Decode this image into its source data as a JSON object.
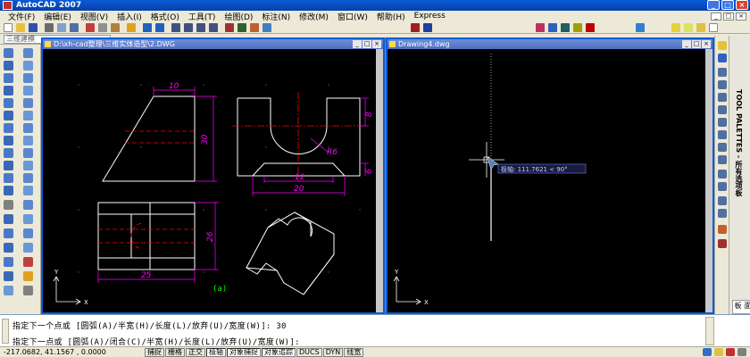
{
  "app": {
    "title": "AutoCAD 2007"
  },
  "menu": [
    "文件(F)",
    "编辑(E)",
    "视图(V)",
    "插入(I)",
    "格式(O)",
    "工具(T)",
    "绘图(D)",
    "标注(N)",
    "修改(M)",
    "窗口(W)",
    "帮助(H)",
    "Express"
  ],
  "toolbar": {
    "layer_combo": "三维建模"
  },
  "left_window": {
    "title": "D:\\xh-cad整理\\三维实体造型\\2.DWG",
    "dims": {
      "d10": "10",
      "d30": "30",
      "d8": "8",
      "r6": "R6",
      "d6": "6",
      "d12": "12",
      "d20": "20",
      "d26": "26",
      "d25": "25"
    },
    "caption": "(a)",
    "ucs_x": "X",
    "ucs_y": "Y"
  },
  "right_window": {
    "title": "Drawing4.dwg",
    "tooltip": "极轴: 111.7621 < 90°",
    "ucs_x": "X",
    "ucs_y": "Y"
  },
  "palettes": {
    "label": "TOOL PALETTES - 所有选项板",
    "tab": "面板"
  },
  "command": {
    "line1": "指定下一个点或 [圆弧(A)/半宽(H)/长度(L)/放弃(U)/宽度(W)]: 30",
    "line2": "指定下一点或 [圆弧(A)/闭合(C)/半宽(H)/长度(L)/放弃(U)/宽度(W)]:"
  },
  "status": {
    "coords": "-217.0682, 41.1567 , 0.0000",
    "buttons": [
      "捕捉",
      "栅格",
      "正交",
      "极轴",
      "对象捕捉",
      "对象追踪",
      "DUCS",
      "DYN",
      "线宽"
    ]
  },
  "colors": {
    "dimension": "#ff00ff",
    "centerline": "#ff0000",
    "object": "#ffffff",
    "caption": "#00ff00",
    "title_bar": "#0a5bd6"
  }
}
